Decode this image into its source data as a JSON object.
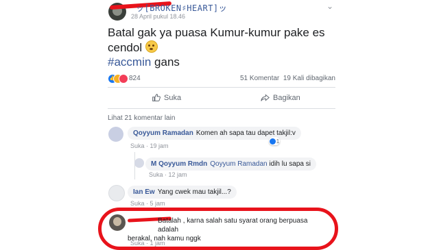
{
  "post": {
    "author_name": "ッ[BROKEN♯HEART]ッ",
    "timestamp": "28 April pukul 18.46",
    "more_icon": "chevron-down-icon",
    "text": "Batal gak ya puasa Kumur-kumur pake es cendol",
    "hashtag": "#accmin",
    "hashtag_suffix": " gans",
    "reactions_count": "824",
    "comments_count": "51 Komentar",
    "shares_count": "19 Kali dibagikan"
  },
  "actions": {
    "like_label": "Suka",
    "share_label": "Bagikan"
  },
  "comments": {
    "more_comments": "Lihat 21 komentar lain",
    "items": [
      {
        "name": "Qoyyum Ramadan",
        "text": "Komen ah sapa tau dapet takjil:v",
        "like_label": "Suka",
        "time": "19 jam",
        "reaction_count": "1"
      },
      {
        "name": "M Qoyyum Rmdn",
        "mention": "Qoyyum Ramadan",
        "text": "idih lu sapa si",
        "like_label": "Suka",
        "time": "12 jam"
      },
      {
        "name": "Ian Ew",
        "text": "Yang cwek mau takjil...?",
        "like_label": "Suka",
        "time": "5 jam"
      },
      {
        "text_line1": "Batalah , karna salah satu syarat orang berpuasa adalah",
        "text_line2": "berakal, nah kamu nggk",
        "like_label": "Suka",
        "time": "1 jam"
      }
    ]
  },
  "colors": {
    "link_blue": "#385898",
    "annotation_red": "#e8131b",
    "bubble_bg": "#f2f3f5"
  }
}
